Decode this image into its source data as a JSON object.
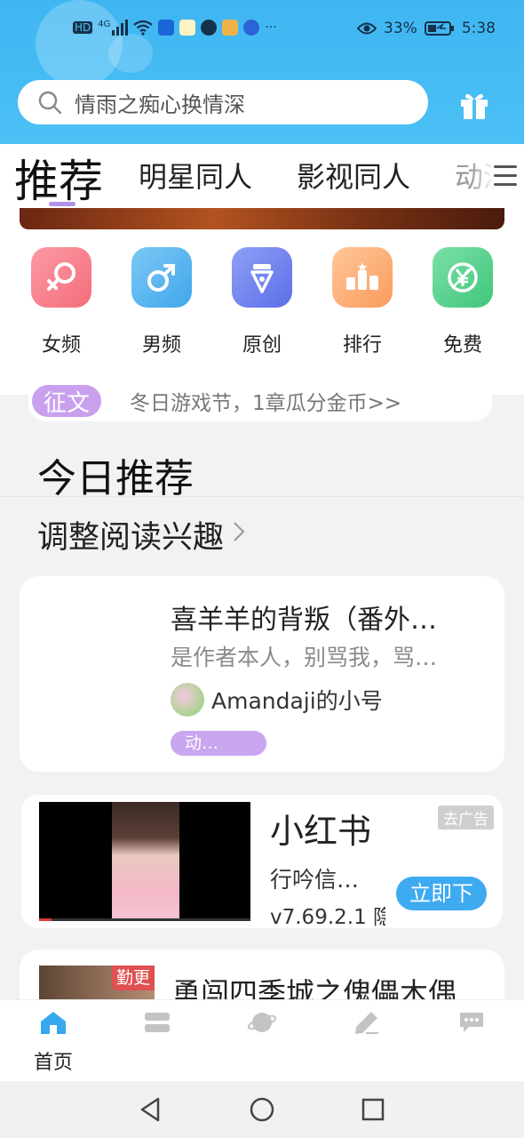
{
  "status_bar": {
    "network_left": "HD",
    "signal": "4G",
    "battery": "33%",
    "time": "5:38",
    "more": "···"
  },
  "search": {
    "placeholder": "情雨之痴心换情深"
  },
  "tabs": [
    {
      "label": "推荐",
      "active": true
    },
    {
      "label": "明星同人",
      "active": false
    },
    {
      "label": "影视同人",
      "active": false
    },
    {
      "label": "动漫",
      "active": false
    }
  ],
  "categories": [
    {
      "label": "女频",
      "icon": "female-icon",
      "color": "#f87a86"
    },
    {
      "label": "男频",
      "icon": "male-icon",
      "color": "#57b8f1"
    },
    {
      "label": "原创",
      "icon": "pen-nib-icon",
      "color": "#6d82f0"
    },
    {
      "label": "排行",
      "icon": "ranking-icon",
      "color": "#fba970"
    },
    {
      "label": "免费",
      "icon": "yen-icon",
      "color": "#55d38b"
    }
  ],
  "notice": {
    "tag": "征文",
    "text": "冬日游戏节，1章瓜分金币>>"
  },
  "section": {
    "title": "今日推荐",
    "interest": "调整阅读兴趣"
  },
  "book": {
    "title": "喜羊羊的背叛（番外…",
    "desc": "是作者本人，别骂我，骂…",
    "author": "Amandaji的小号",
    "genre": "动…"
  },
  "ad": {
    "app_name": "小红书",
    "sub": "行吟信…",
    "version": "v7.69.2.1 隐",
    "tag": "去广告",
    "button": "立即下"
  },
  "book2": {
    "badge": "勤更",
    "title": "勇闯四季城之傀儡木偶"
  },
  "bottom_nav": [
    {
      "label": "首页",
      "icon": "home-icon",
      "active": true
    },
    {
      "label": "",
      "icon": "library-icon",
      "active": false
    },
    {
      "label": "",
      "icon": "planet-icon",
      "active": false
    },
    {
      "label": "",
      "icon": "write-icon",
      "active": false
    },
    {
      "label": "",
      "icon": "chat-icon",
      "active": false
    }
  ],
  "colors": {
    "header": "#3fb6f2",
    "accent_purple": "#c9a0ee",
    "download_blue": "#3eaaf0"
  }
}
